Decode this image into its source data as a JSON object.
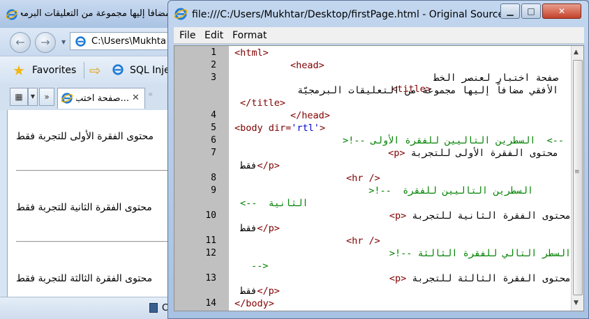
{
  "browser": {
    "title": "مضافاً إليها مجموعة من التعليقات البرمجيّة",
    "address": "C:\\Users\\Mukhta",
    "favorites_label": "Favorites",
    "fav_link": "SQL Inje",
    "tab_label": "...صفحة اختب",
    "tab_close": "✕",
    "tab_overflow": "»",
    "tab_new": "«",
    "content": {
      "paragraphs": [
        "محتوى الفقرة الأولى للتجربة فقط",
        "محتوى الفقرة الثانية للتجربة فقط",
        "محتوى الفقرة الثالثة للتجربة فقط"
      ]
    },
    "status_text": "C"
  },
  "source_window": {
    "title": "file:///C:/Users/Mukhtar/Desktop/firstPage.html - Original Source",
    "menu": [
      "File",
      "Edit",
      "Format"
    ],
    "line_numbers": [
      "1",
      "2",
      "3",
      "4",
      "5",
      "6",
      "7",
      "8",
      "9",
      "10",
      "11",
      "12",
      "13",
      "14"
    ],
    "code": {
      "l1": "<html>",
      "l2": "<head>",
      "l3_open": "<title>",
      "l3_text_a": "صفحة اختبار لعنصر الخط",
      "l3_text_b": "الأفقي مضافاً إليها مجموعة من التعليقات البرمجيّة",
      "l3_close": "</title>",
      "l4": "</head>",
      "l5_tag": "<body ",
      "l5_attr": "dir=",
      "l5_val": "'rtl'",
      "l5_end": ">",
      "l6": "-->  السطرين التاليين للفقرة الأولى --!<",
      "l7_text": "محتوى الفقرة الأولى للتجربة",
      "l7_tag": "<p>",
      "l7b_text": "فقط",
      "l7b_tag": "</p>",
      "l8": "<hr />",
      "l9_a": "السطرين التاليين للفقرة  --!<",
      "l9_b": "الثانية  -->",
      "l10_text": "محتوى الفقرة الثانية للتجربة",
      "l10_tag": "<p>",
      "l10b_text": "فقط",
      "l10b_tag": "</p>",
      "l11": "<hr />",
      "l12_a": "السطر التالي للفقرة الثالثة --!<",
      "l12_b": "-->",
      "l13_text": "محتوى الفقرة الثالثة للتجربة",
      "l13_tag": "<p>",
      "l13b_text": "فقط",
      "l13b_tag": "</p>",
      "l14": "</body>"
    },
    "colors": {
      "tag": "#800000",
      "value": "#0000cc",
      "comment": "#008000",
      "gutter": "#c0c0c0"
    }
  }
}
